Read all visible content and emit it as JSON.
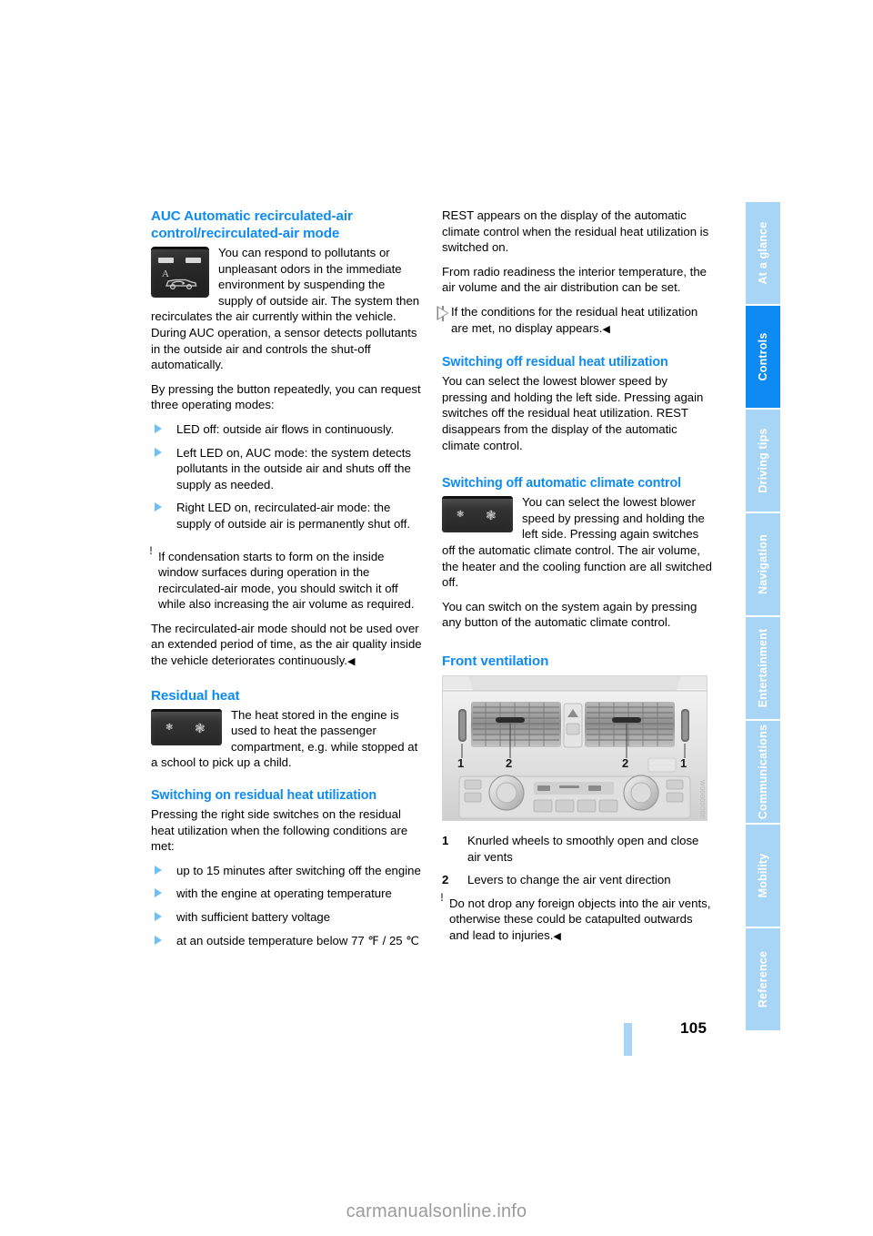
{
  "page": {
    "number": "105",
    "footer_watermark": "carmanualsonline.info",
    "figure_id": "W00000000"
  },
  "tabs": [
    {
      "label": "At a glance",
      "active": false
    },
    {
      "label": "Controls",
      "active": true
    },
    {
      "label": "Driving tips",
      "active": false
    },
    {
      "label": "Navigation",
      "active": false
    },
    {
      "label": "Entertainment",
      "active": false
    },
    {
      "label": "Communications",
      "active": false
    },
    {
      "label": "Mobility",
      "active": false
    },
    {
      "label": "Reference",
      "active": false
    }
  ],
  "colors": {
    "heading_blue": "#0d8bf2",
    "subheading_blue": "#68b8ef",
    "tab_inactive": "#a8d4f5",
    "tab_active": "#0d8bf2"
  },
  "left_column": {
    "section_title": "AUC Automatic recirculated-air control/recirculated-air mode",
    "intro_paragraph": "You can respond to pollutants or unpleasant odors in the immediate environment by suspending the supply of outside air. The system then recirculates the air currently within the vehicle. During AUC operation, a sensor detects pollutants in the outside air and controls the shut-off automatically.",
    "modes_intro": "By pressing the button repeatedly, you can request three operating modes:",
    "modes": [
      "LED off: outside air flows in continuously.",
      "Left LED on, AUC mode: the system detects pollutants in the outside air and shuts off the supply as needed.",
      "Right LED on, recirculated-air mode: the supply of outside air is permanently shut off."
    ],
    "warning_1": "If condensation starts to form on the inside window surfaces during operation in the recirculated-air mode, you should switch it off while also increasing the air volume as required.",
    "warning_1_cont": "The recirculated-air mode should not be used over an extended period of time, as the air quality inside the vehicle deteriorates continuously.",
    "residual_heat_title": "Residual heat",
    "residual_heat_paragraph": "The heat stored in the engine is used to heat the passenger compartment, e.g. while stopped at a school to pick up a child.",
    "switch_on_title": "Switching on residual heat utilization",
    "switch_on_paragraph": "Pressing the right side switches on the residual heat utilization when the following conditions are met:",
    "conditions": [
      "up to 15 minutes after switching off the engine",
      "with the engine at operating temperature",
      "with sufficient battery voltage",
      "at an outside temperature below 77 ℉ / 25 ℃"
    ],
    "auc_button_letter": "A"
  },
  "right_column": {
    "rest_paragraph_1": "REST appears on the display of the automatic climate control when the residual heat utilization is switched on.",
    "rest_paragraph_2": "From radio readiness the interior temperature, the air volume and the air distribution can be set.",
    "note_1": "If the conditions for the residual heat utilization are met, no display appears.",
    "switch_off_rest_title": "Switching off residual heat utilization",
    "switch_off_rest_paragraph": "You can select the lowest blower speed by pressing and holding the left side. Pressing again switches off the residual heat utilization. REST disappears from the display of the automatic climate control.",
    "switch_off_acc_title": "Switching off automatic climate control",
    "switch_off_acc_paragraph": "You can select the lowest blower speed by pressing and holding the left side. Pressing again switches off the automatic climate control. The air volume, the heater and the cooling function are all switched off.",
    "switch_on_again_paragraph": "You can switch on the system again by pressing any button of the automatic climate control.",
    "front_ventilation_title": "Front ventilation",
    "legend": [
      {
        "num": "1",
        "text": "Knurled wheels to smoothly open and close air vents"
      },
      {
        "num": "2",
        "text": "Levers to change the air vent direction"
      }
    ],
    "warning_2": "Do not drop any foreign objects into the air vents, otherwise these could be catapulted outwards and lead to injuries.",
    "vent_callouts": [
      "1",
      "2",
      "2",
      "1"
    ]
  }
}
